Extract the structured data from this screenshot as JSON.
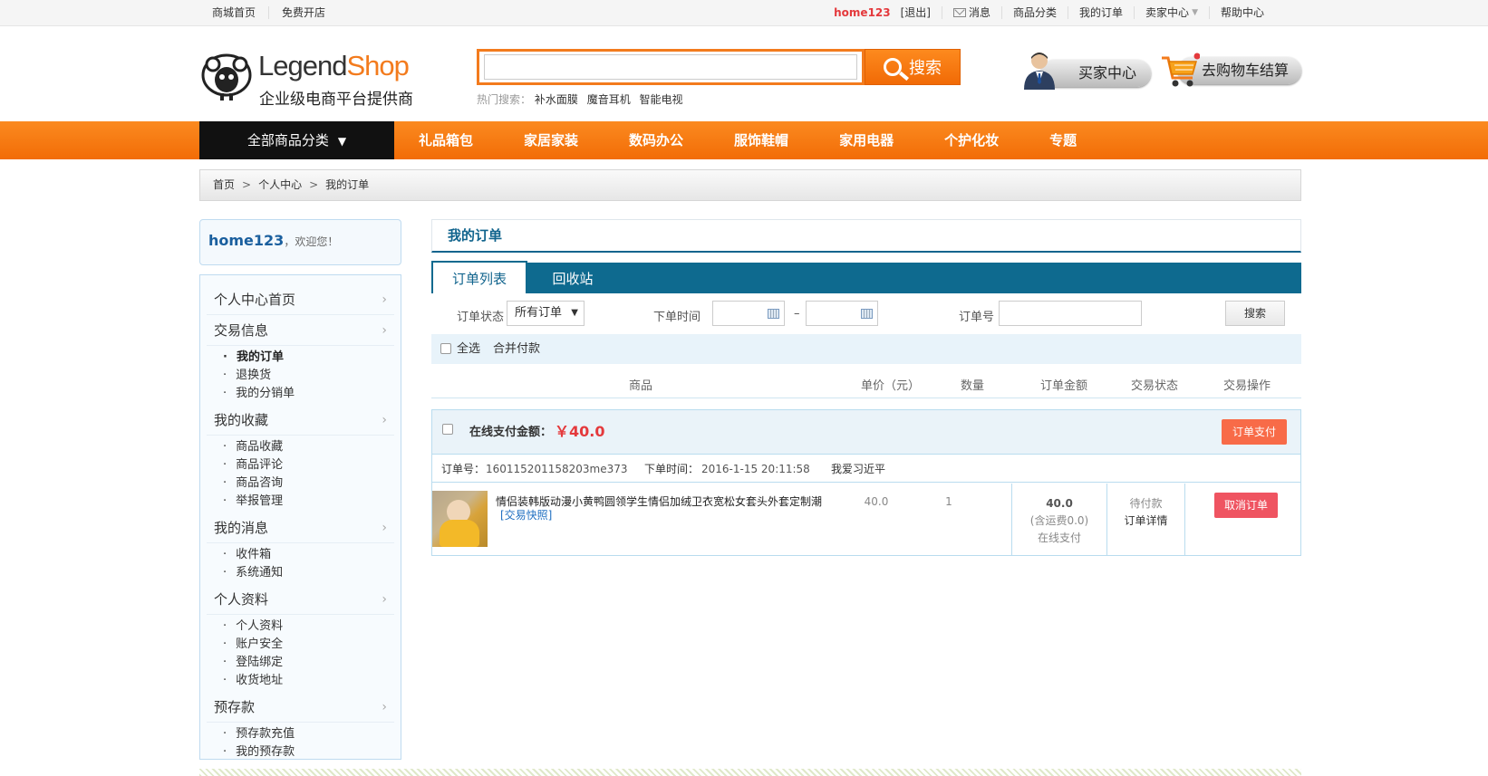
{
  "topbar": {
    "left": [
      "商城首页",
      "免费开店"
    ],
    "user": "home123",
    "logout": "[退出]",
    "messages": "消息",
    "categories": "商品分类",
    "my_orders": "我的订单",
    "seller_center": "卖家中心",
    "help": "帮助中心"
  },
  "header": {
    "logo_main_1": "Legend",
    "logo_main_2": "Shop",
    "logo_sub": "企业级电商平台提供商",
    "search_value": "",
    "search_button": "搜索",
    "hot_label": "热门搜索：",
    "hot_keywords": [
      "补水面膜",
      "魔音耳机",
      "智能电视"
    ],
    "buyer_center": "买家中心",
    "cart_checkout": "去购物车结算"
  },
  "nav": {
    "all_categories": "全部商品分类",
    "links": [
      "礼品箱包",
      "家居家装",
      "数码办公",
      "服饰鞋帽",
      "家用电器",
      "个护化妆",
      "专题"
    ]
  },
  "breadcrumb": [
    "首页",
    "个人中心",
    "我的订单"
  ],
  "sidebar": {
    "username": "home123",
    "welcome": "，欢迎您！",
    "groups": [
      {
        "title": "个人中心首页",
        "items": []
      },
      {
        "title": "交易信息",
        "items": [
          "我的订单",
          "退换货",
          "我的分销单"
        ]
      },
      {
        "title": "我的收藏",
        "items": [
          "商品收藏",
          "商品评论",
          "商品咨询",
          "举报管理"
        ]
      },
      {
        "title": "我的消息",
        "items": [
          "收件箱",
          "系统通知"
        ]
      },
      {
        "title": "个人资料",
        "items": [
          "个人资料",
          "账户安全",
          "登陆绑定",
          "收货地址"
        ]
      },
      {
        "title": "预存款",
        "items": [
          "预存款充值",
          "我的预存款"
        ]
      }
    ],
    "active_item": "我的订单"
  },
  "main": {
    "title": "我的订单",
    "tabs": [
      "订单列表",
      "回收站"
    ],
    "filter": {
      "status_label": "订单状态",
      "status_value": "所有订单",
      "time_label": "下单时间",
      "dash": "–",
      "order_no_label": "订单号",
      "search_button": "搜索"
    },
    "select_all": "全选",
    "merge_pay": "合并付款",
    "columns": [
      "商品",
      "单价（元）",
      "数量",
      "订单金额",
      "交易状态",
      "交易操作"
    ],
    "order": {
      "pay_label": "在线支付金额：",
      "pay_amount": "￥40.0",
      "pay_button": "订单支付",
      "order_no_label": "订单号：",
      "order_no": "160115201158203me373",
      "time_label": "下单时间：",
      "time": "2016-1-15 20:11:58",
      "shop": "我爱习近平",
      "product_name": "情侣装韩版动漫小黄鸭圆领学生情侣加绒卫衣宽松女套头外套定制潮",
      "snapshot": "[交易快照]",
      "price": "40.0",
      "quantity": "1",
      "total": "40.0",
      "shipping": "(含运费0.0)",
      "pay_method": "在线支付",
      "status": "待付款",
      "detail": "订单详情",
      "cancel_button": "取消订单"
    }
  },
  "colors": {
    "accent": "#f37b1d",
    "primary": "#11648d",
    "price": "#e4393c",
    "cancel": "#ef5461"
  }
}
